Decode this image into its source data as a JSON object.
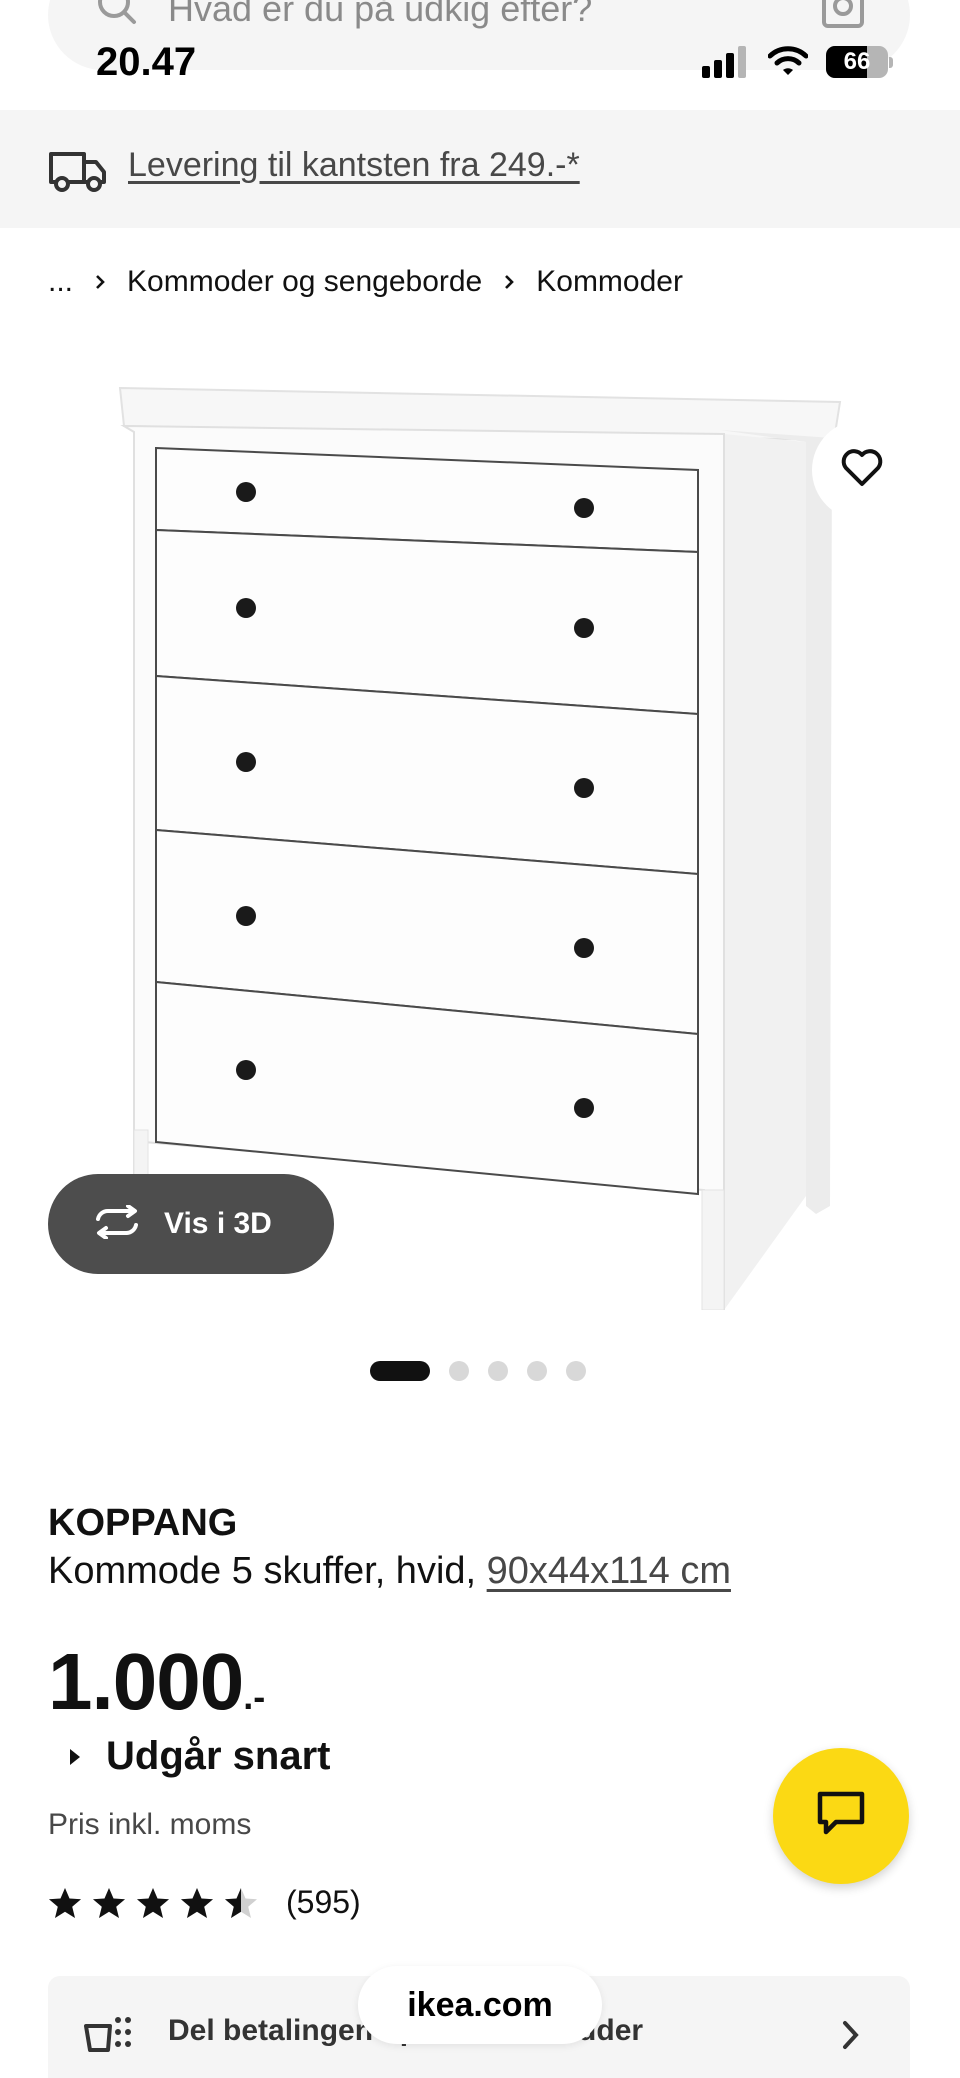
{
  "search": {
    "placeholder": "Hvad er du på udkig efter?"
  },
  "status_bar": {
    "time": "20.47",
    "battery": "66",
    "battery_level": 0.66
  },
  "delivery_banner": {
    "text": "Levering til kantsten fra 249.-*"
  },
  "breadcrumb": {
    "ellipsis": "...",
    "items": [
      "Kommoder og sengeborde",
      "Kommoder"
    ]
  },
  "gallery": {
    "view_3d_label": "Vis i 3D",
    "image_count": 5,
    "active_index": 0
  },
  "product": {
    "name": "KOPPANG",
    "description": "Kommode 5 skuffer, hvid, ",
    "dimensions": "90x44x114 cm",
    "price": "1.000",
    "price_suffix": ".-",
    "status": "Udgår snart",
    "vat_note": "Pris inkl. moms",
    "rating": 4.5,
    "review_count": "(595)"
  },
  "payment": {
    "text": "Del betalingen op i mindre bidder"
  },
  "browser": {
    "url": "ikea.com"
  },
  "colors": {
    "accent_yellow": "#fbd914",
    "banner_bg": "#f5f5f5",
    "button_dark": "#4d4d4d"
  },
  "icons": [
    "search-icon",
    "camera-icon",
    "truck-icon",
    "heart-icon",
    "rotate-3d-icon",
    "star-icon",
    "chat-icon",
    "payment-icon",
    "chevron-right-icon"
  ]
}
